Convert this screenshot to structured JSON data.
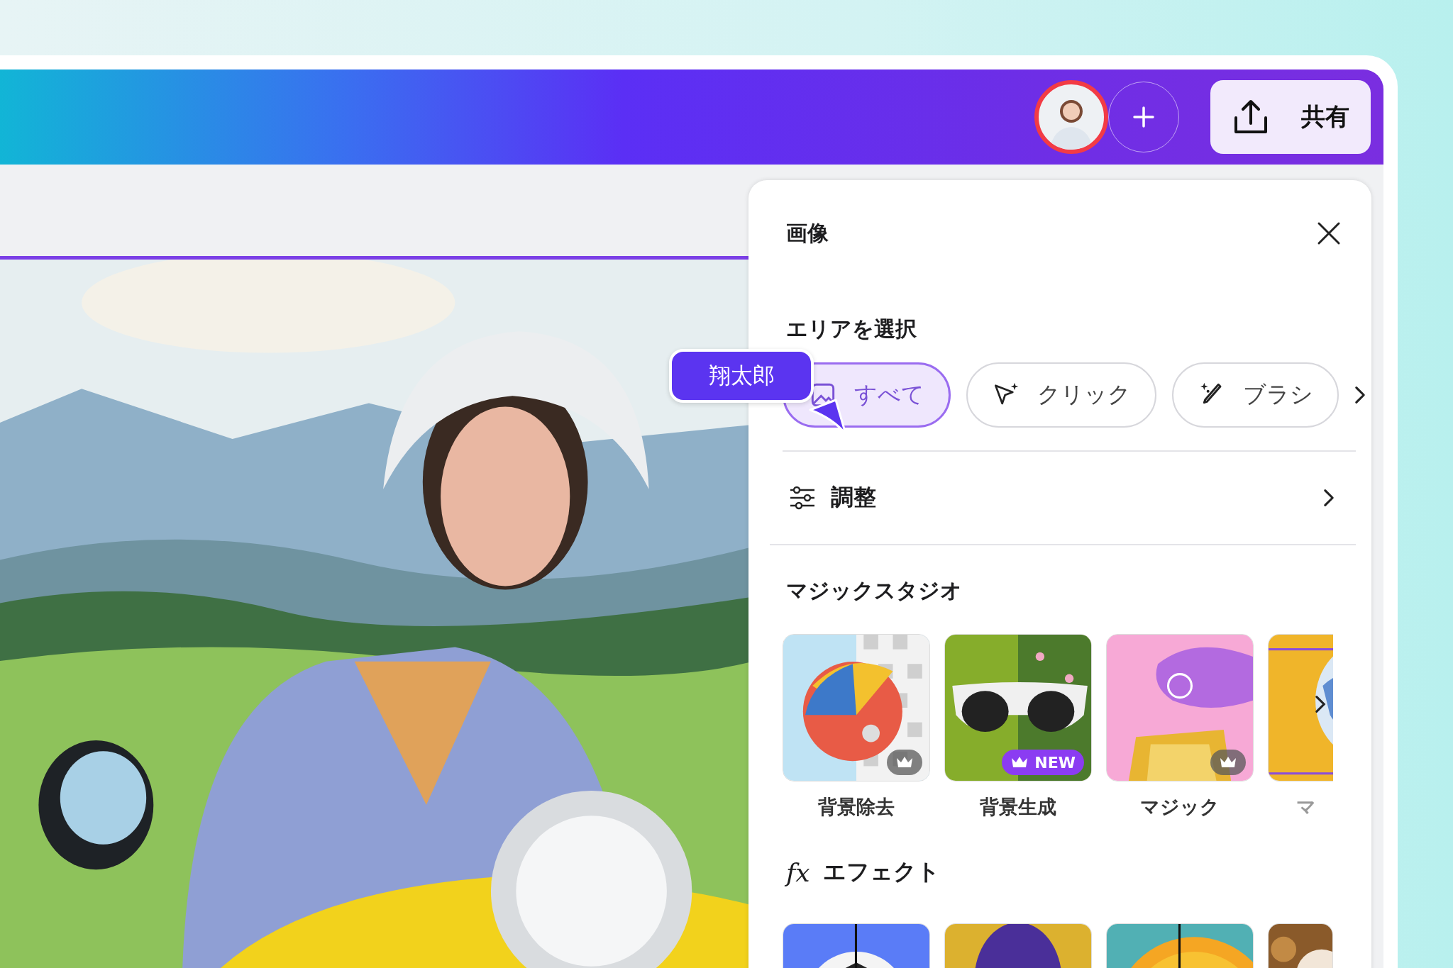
{
  "header": {
    "share_label": "共有"
  },
  "collaborator_tag": "翔太郎",
  "panel": {
    "title": "画像",
    "select_area": {
      "heading": "エリアを選択",
      "options": [
        {
          "label": "すべて",
          "selected": true
        },
        {
          "label": "クリック",
          "selected": false
        },
        {
          "label": "ブラシ",
          "selected": false
        }
      ]
    },
    "adjust": {
      "label": "調整"
    },
    "magic_studio": {
      "heading": "マジックスタジオ",
      "tools": [
        {
          "label": "背景除去",
          "premium": true
        },
        {
          "label": "背景生成",
          "premium": true,
          "badge": "NEW"
        },
        {
          "label": "マジック",
          "premium": true
        },
        {
          "label": "マ"
        }
      ]
    },
    "effects": {
      "icon_text": "fx",
      "heading": "エフェクト"
    }
  }
}
